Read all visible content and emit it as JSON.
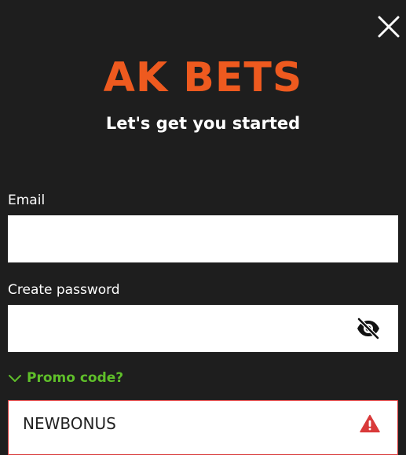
{
  "header": {
    "logo_text": "AK BETS",
    "subtitle": "Let's get you started"
  },
  "form": {
    "email": {
      "label": "Email",
      "value": "",
      "placeholder": ""
    },
    "password": {
      "label": "Create password",
      "value": "",
      "placeholder": ""
    },
    "promo": {
      "toggle_label": "Promo code?",
      "value": "NEWBONUS",
      "state": "error"
    }
  },
  "icons": {
    "close": "close-icon",
    "password_visibility": "eye-slash-icon",
    "promo_toggle": "chevron-down-icon",
    "promo_error": "warning-icon"
  },
  "colors": {
    "background": "#1e1e1e",
    "brand": "#ee5a1f",
    "promo_link": "#5fbf2a",
    "error": "#d93a3a",
    "input_background": "#ffffff"
  }
}
